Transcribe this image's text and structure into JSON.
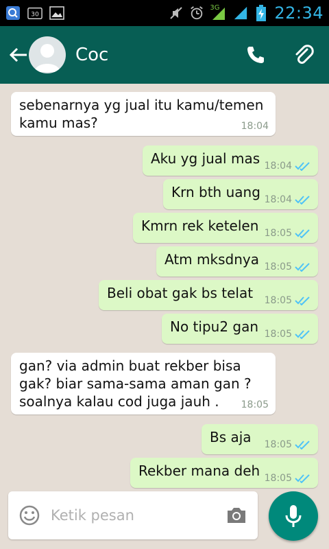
{
  "status_bar": {
    "network": "3G",
    "time": "22:34"
  },
  "header": {
    "contact_name": "Coc"
  },
  "messages": [
    {
      "dir": "in",
      "text": "sebenarnya yg jual itu kamu/temen\nkamu mas?",
      "time": "18:04"
    },
    {
      "dir": "out",
      "text": "Aku yg jual mas",
      "time": "18:04"
    },
    {
      "dir": "out",
      "text": "Krn bth uang",
      "time": "18:04"
    },
    {
      "dir": "out",
      "text": "Kmrn rek ketelen",
      "time": "18:05"
    },
    {
      "dir": "out",
      "text": "Atm mksdnya",
      "time": "18:05"
    },
    {
      "dir": "out",
      "text": "Beli obat gak bs telat",
      "time": "18:05"
    },
    {
      "dir": "out",
      "text": "No tipu2 gan",
      "time": "18:05"
    },
    {
      "dir": "in",
      "text": "gan? via admin buat rekber bisa\ngak? biar sama-sama aman gan ?\nsoalnya kalau cod juga jauh .",
      "time": "18:05"
    },
    {
      "dir": "out",
      "text": "Bs aja",
      "time": "18:05"
    },
    {
      "dir": "out",
      "text": "Rekber mana deh",
      "time": "18:05"
    }
  ],
  "input": {
    "placeholder": "Ketik pesan"
  },
  "colors": {
    "header": "#075e54",
    "outgoing_bubble": "#dcf8c6",
    "incoming_bubble": "#ffffff",
    "read_ticks": "#4fc3f7",
    "mic_button": "#00897b"
  }
}
